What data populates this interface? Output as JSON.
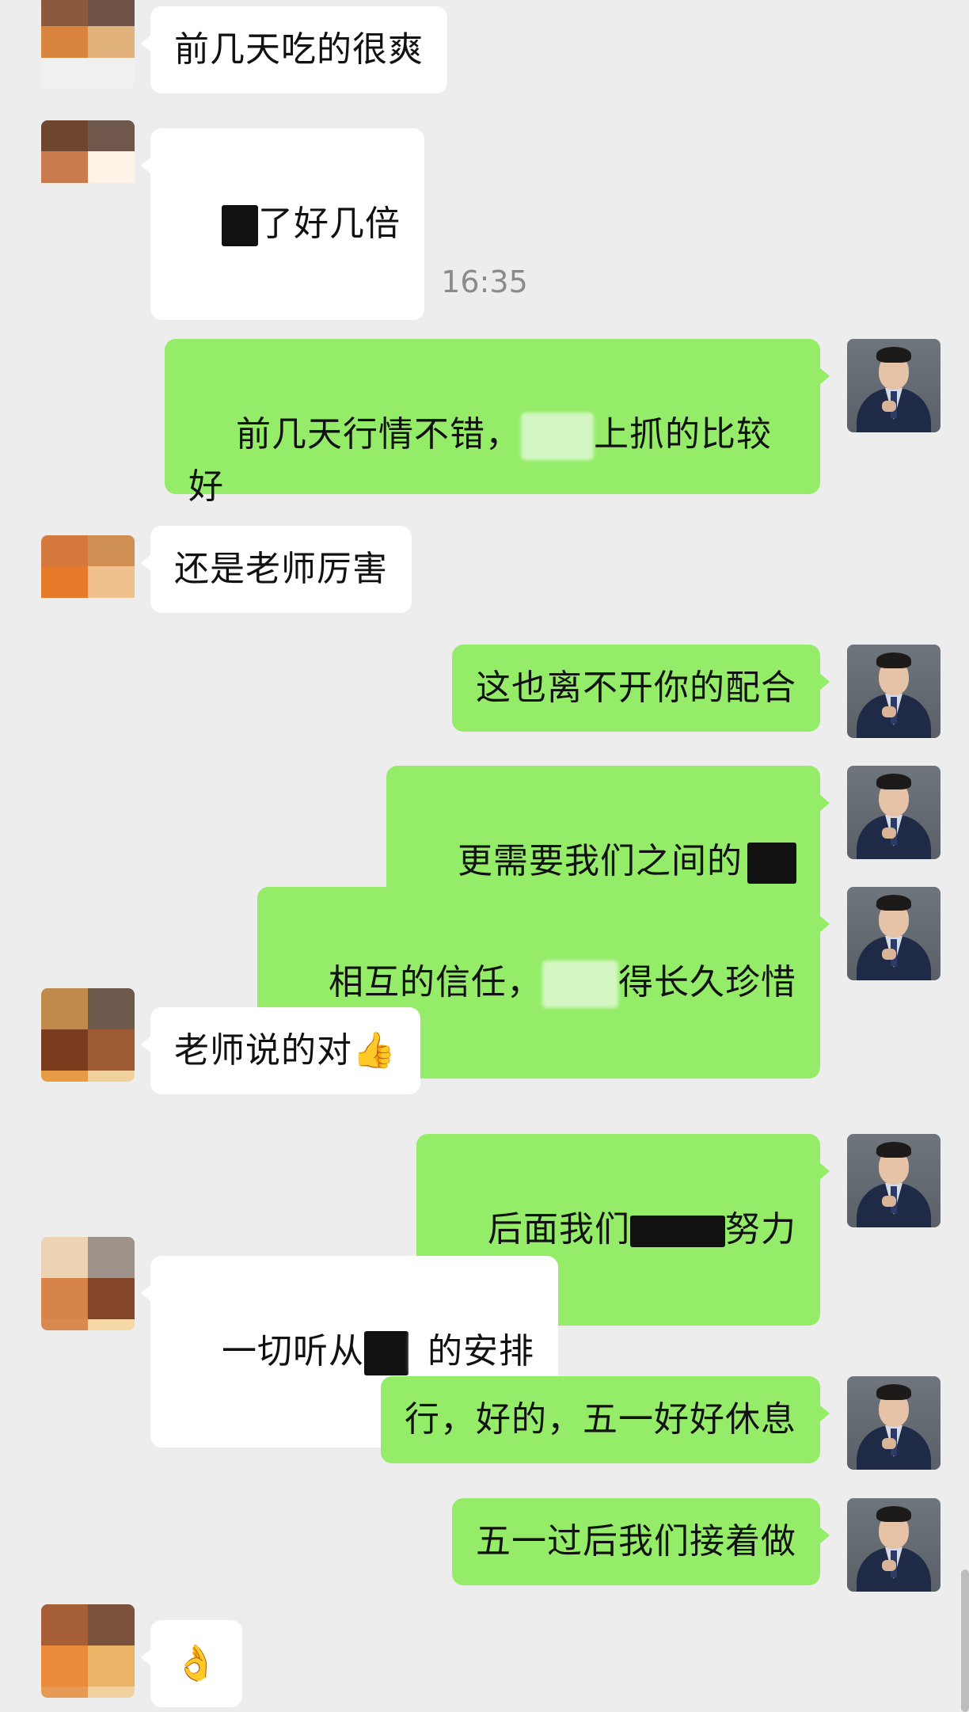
{
  "chat": {
    "timestamp": "16:35",
    "messages": [
      {
        "side": "left",
        "text": "前几天吃的很爽"
      },
      {
        "side": "left",
        "text": "了好几倍"
      },
      {
        "side": "right",
        "line1": "前几天行情不错，",
        "line1b": "上抓的比较",
        "line2": "好"
      },
      {
        "side": "left",
        "text": "还是老师厉害"
      },
      {
        "side": "right",
        "text": "这也离不开你的配合"
      },
      {
        "side": "right",
        "text": "更需要我们之间的"
      },
      {
        "side": "right",
        "text_a": "相互的信任，",
        "text_b": "得长久珍惜"
      },
      {
        "side": "left",
        "text": "老师说的对👍"
      },
      {
        "side": "right",
        "text_a": "后面我们",
        "text_b": "努力"
      },
      {
        "side": "left",
        "text_a": "一切听从",
        "text_b": "的安排"
      },
      {
        "side": "right",
        "text": "行，好的，五一好好休息"
      },
      {
        "side": "right",
        "text": "五一过后我们接着做"
      },
      {
        "side": "left",
        "text": "👌"
      }
    ]
  },
  "colors": {
    "background": "#ededed",
    "bubble_right": "#95ec69",
    "bubble_left": "#ffffff",
    "timestamp": "#8a8a8a"
  },
  "icons": {
    "teacher_avatar": "teacher-avatar-icon",
    "user_avatar": "user-avatar-icon"
  }
}
